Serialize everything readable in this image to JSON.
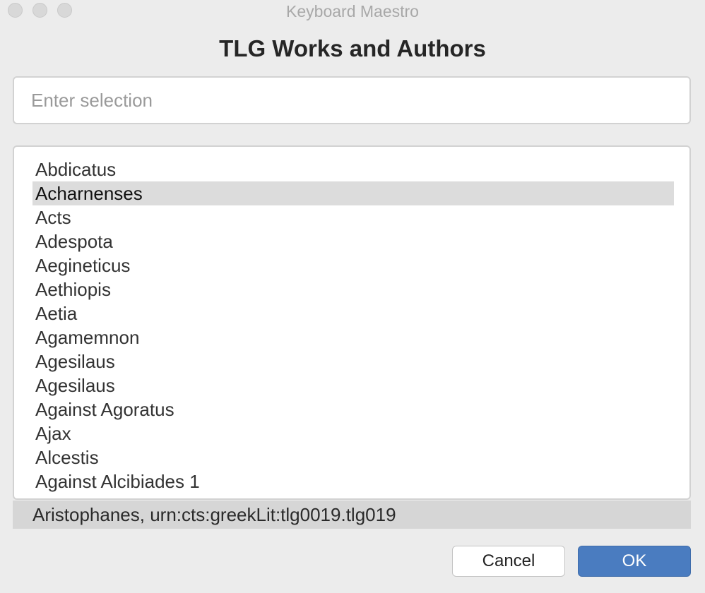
{
  "window": {
    "title": "Keyboard Maestro"
  },
  "dialog": {
    "heading": "TLG Works and Authors"
  },
  "search": {
    "placeholder": "Enter selection",
    "value": ""
  },
  "list": {
    "selected_index": 1,
    "items": [
      {
        "label": "Abdicatus"
      },
      {
        "label": "Acharnenses"
      },
      {
        "label": "Acts"
      },
      {
        "label": "Adespota"
      },
      {
        "label": "Aegineticus"
      },
      {
        "label": "Aethiopis"
      },
      {
        "label": "Aetia"
      },
      {
        "label": "Agamemnon"
      },
      {
        "label": "Agesilaus"
      },
      {
        "label": "Agesilaus"
      },
      {
        "label": "Against Agoratus"
      },
      {
        "label": "Ajax"
      },
      {
        "label": "Alcestis"
      },
      {
        "label": "Against Alcibiades 1"
      }
    ]
  },
  "status": {
    "text": "Aristophanes, urn:cts:greekLit:tlg0019.tlg019"
  },
  "buttons": {
    "cancel_label": "Cancel",
    "ok_label": "OK"
  },
  "colors": {
    "accent": "#4a7cc0",
    "selection": "#dcdcdc",
    "background": "#ececec"
  }
}
